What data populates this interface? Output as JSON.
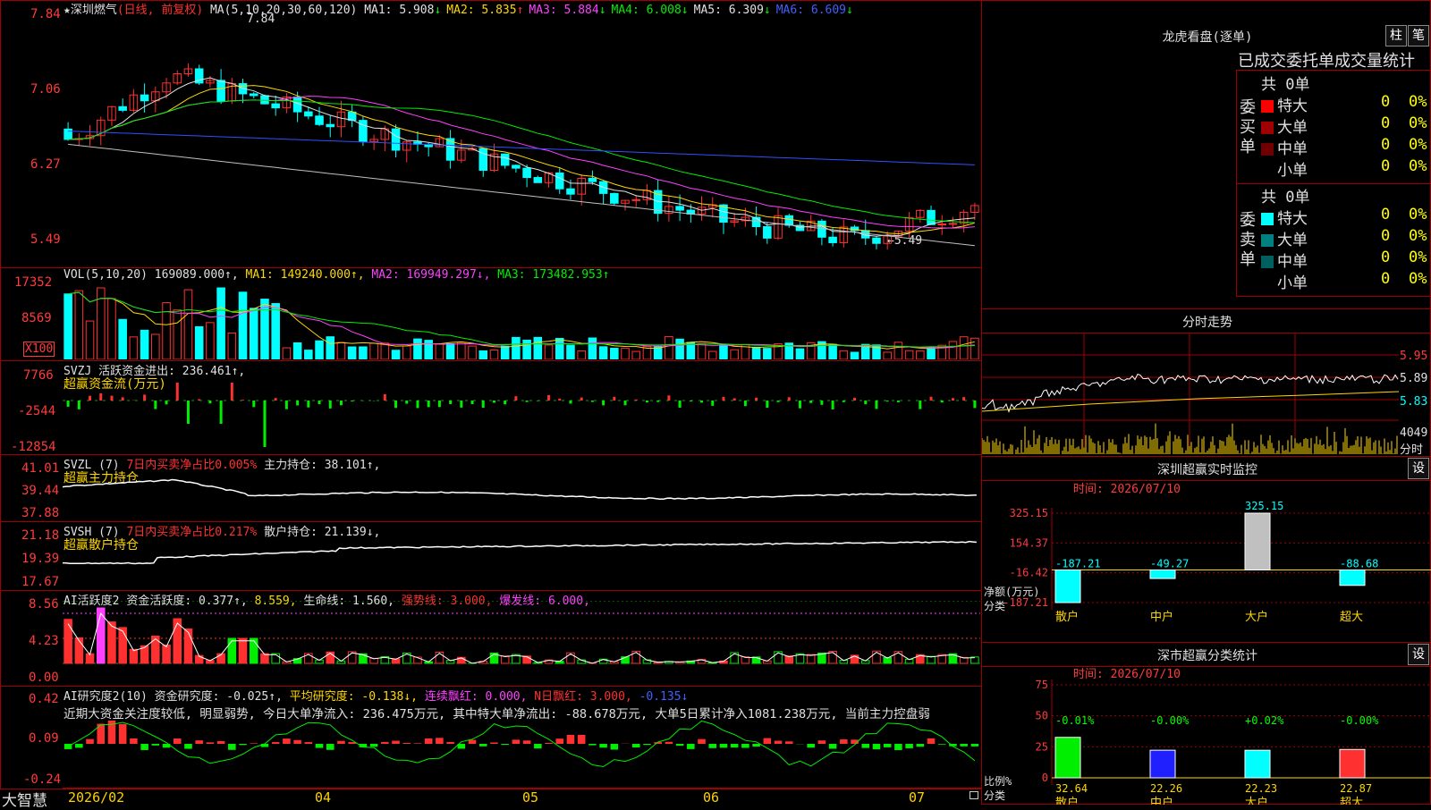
{
  "app": {
    "brand": "大智慧"
  },
  "main": {
    "star": "★",
    "stock_name": "深圳燃气",
    "period": "(日线, 前复权)",
    "ma_header": "MA(5,10,20,30,60,120)",
    "ma_values": [
      {
        "label": "MA1: 5.908",
        "arrow": "↓",
        "color": "#e0e0e0"
      },
      {
        "label": "MA2: 5.835",
        "arrow": "↑",
        "color": "#ffd700"
      },
      {
        "label": "MA3: 5.884",
        "arrow": "↓",
        "color": "#ff40ff"
      },
      {
        "label": "MA4: 6.008",
        "arrow": "↓",
        "color": "#00ee00"
      },
      {
        "label": "MA5: 6.309",
        "arrow": "↓",
        "color": "#e0e0e0"
      },
      {
        "label": "MA6: 6.609",
        "arrow": "↓",
        "color": "#4060ff"
      }
    ],
    "y_ticks": [
      "7.84",
      "7.06",
      "6.27",
      "5.49"
    ],
    "high_marker": "7.84",
    "low_marker": "←5.49"
  },
  "volume": {
    "header": "VOL(5,10,20)",
    "value": "169089.000↑,",
    "ma1": "MA1: 149240.000↑,",
    "ma2": "MA2: 169949.297↓,",
    "ma3": "MA3: 173482.953↑",
    "y_ticks": [
      "17352",
      "8569"
    ],
    "unit": "X100"
  },
  "svzj": {
    "header": "SVZJ",
    "desc": "活跃资金进出: 236.461↑,",
    "name": "超赢资金流(万元)",
    "y_ticks": [
      "7766",
      "-2544",
      "-12854"
    ]
  },
  "svzl": {
    "header": "SVZL (7)",
    "desc": "7日内买卖净占比0.005%",
    "extra": "主力持仓: 38.101↑,",
    "name": "超赢主力持仓",
    "y_ticks": [
      "41.01",
      "39.44",
      "37.88"
    ]
  },
  "svsh": {
    "header": "SVSH (7)",
    "desc": "7日内买卖净占比0.217%",
    "extra": "散户持仓: 21.139↓,",
    "name": "超赢散户持仓",
    "y_ticks": [
      "21.18",
      "19.39",
      "17.67"
    ]
  },
  "ai1": {
    "header": "AI活跃度2",
    "a": "资金活跃度: 0.377↑,",
    "b": "8.559,",
    "c": "生命线: 1.560,",
    "d": "强势线: 3.000,",
    "e": "爆发线: 6.000,",
    "y_ticks": [
      "8.56",
      "4.23",
      "0.00"
    ]
  },
  "ai2": {
    "header": "AI研究度2(10)",
    "a": "资金研究度: -0.025↑,",
    "b": "平均研究度: -0.138↓,",
    "c": "连续飘红: 0.000,",
    "d": "N日飘红: 3.000,",
    "e": "-0.135↓",
    "comment": "近期大资金关注度较低, 明显弱势, 今日大单净流入: 236.475万元, 其中特大单净流出: -88.678万元, 大单5日累计净入1081.238万元, 当前主力控盘弱",
    "y_ticks": [
      "0.42",
      "0.09",
      "-0.24"
    ]
  },
  "x_axis": [
    "2026/02",
    "04",
    "05",
    "06",
    "07"
  ],
  "right": {
    "lhkp_title": "龙虎看盘(逐单)",
    "btn_zhu": "柱",
    "btn_bi": "笔",
    "stat_title": "已成交委托单成交量统计",
    "buy": {
      "side": "委买单",
      "total": "共 0单",
      "rows": [
        {
          "label": "特大",
          "count": "0",
          "pct": "0%",
          "color": "#ff0000"
        },
        {
          "label": "大单",
          "count": "0",
          "pct": "0%",
          "color": "#a00000"
        },
        {
          "label": "中单",
          "count": "0",
          "pct": "0%",
          "color": "#700000"
        },
        {
          "label": "小单",
          "count": "0",
          "pct": "0%",
          "color": ""
        }
      ]
    },
    "sell": {
      "side": "委卖单",
      "total": "共 0单",
      "rows": [
        {
          "label": "特大",
          "count": "0",
          "pct": "0%",
          "color": "#00ffff"
        },
        {
          "label": "大单",
          "count": "0",
          "pct": "0%",
          "color": "#008080"
        },
        {
          "label": "中单",
          "count": "0",
          "pct": "0%",
          "color": "#006060"
        },
        {
          "label": "小单",
          "count": "0",
          "pct": "0%",
          "color": ""
        }
      ]
    },
    "intraday": {
      "title": "分时走势",
      "prices": [
        "5.95",
        "5.89",
        "5.83"
      ],
      "vol": "4049",
      "vol_unit": "分时"
    },
    "monitor": {
      "title": "深圳超赢实时监控",
      "btn": "设",
      "time": "时间: 2026/07/10",
      "y_ticks": [
        "325.15",
        "154.37",
        "-16.42",
        "-187.21"
      ],
      "ylabel": "净额(万元)",
      "xname": "分类",
      "categories": [
        "散户",
        "中户",
        "大户",
        "超大"
      ],
      "values": [
        -187.21,
        -49.27,
        325.15,
        -88.68
      ],
      "value_labels": [
        "-187.21",
        "-49.27",
        "325.15",
        "-88.68"
      ]
    },
    "classify": {
      "title": "深市超赢分类统计",
      "btn": "设",
      "time": "时间: 2026/07/10",
      "y_ticks": [
        "75",
        "50",
        "25",
        "0"
      ],
      "ylabel": "比例%",
      "xname": "分类",
      "categories": [
        "散户",
        "中户",
        "大户",
        "超大"
      ],
      "values": [
        32.64,
        22.26,
        22.23,
        22.87
      ],
      "changes": [
        "-0.01%",
        "-0.00%",
        "+0.02%",
        "-0.00%"
      ],
      "value_labels": [
        "32.64",
        "22.26",
        "22.23",
        "22.87"
      ]
    }
  }
}
